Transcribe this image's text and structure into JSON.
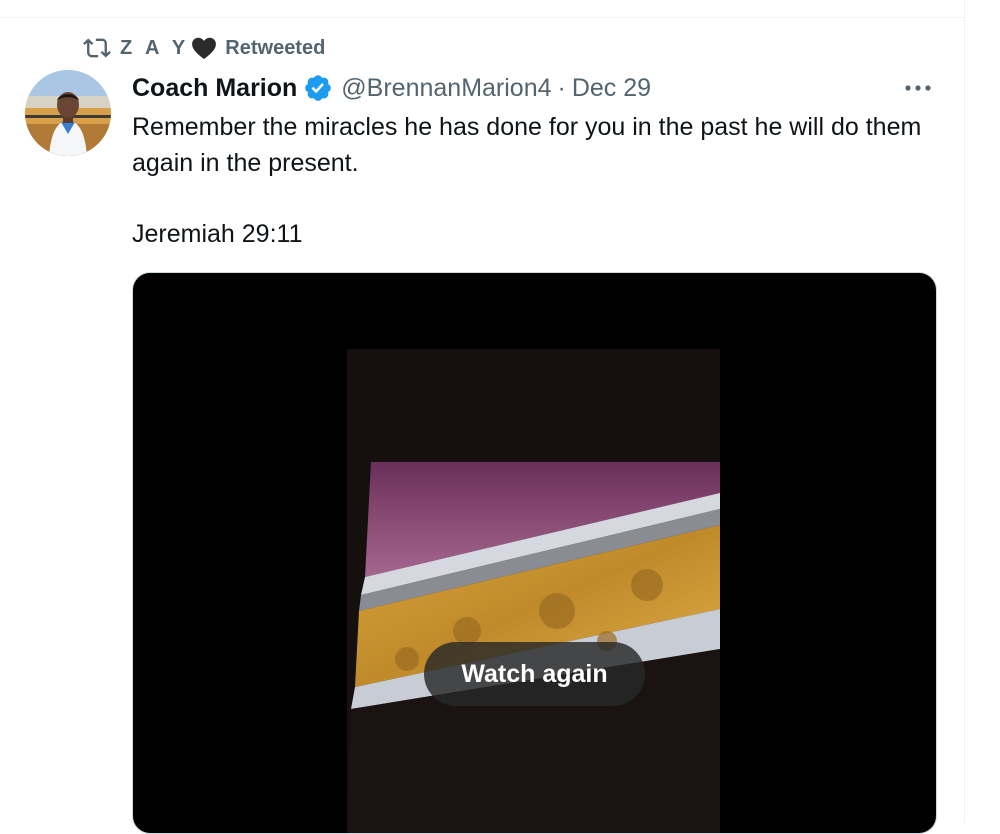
{
  "retweet": {
    "user": "Z A Y",
    "label": "Retweeted"
  },
  "tweet": {
    "display_name": "Coach Marion",
    "handle": "@BrennanMarion4",
    "separator": "·",
    "date": "Dec 29",
    "text": "Remember the miracles he has done for you in the past he will do them again in the present.\n\nJeremiah 29:11"
  },
  "media": {
    "watch_again_label": "Watch again"
  },
  "colors": {
    "text": "#0f1419",
    "secondary": "#536471",
    "verified": "#1d9bf0"
  }
}
